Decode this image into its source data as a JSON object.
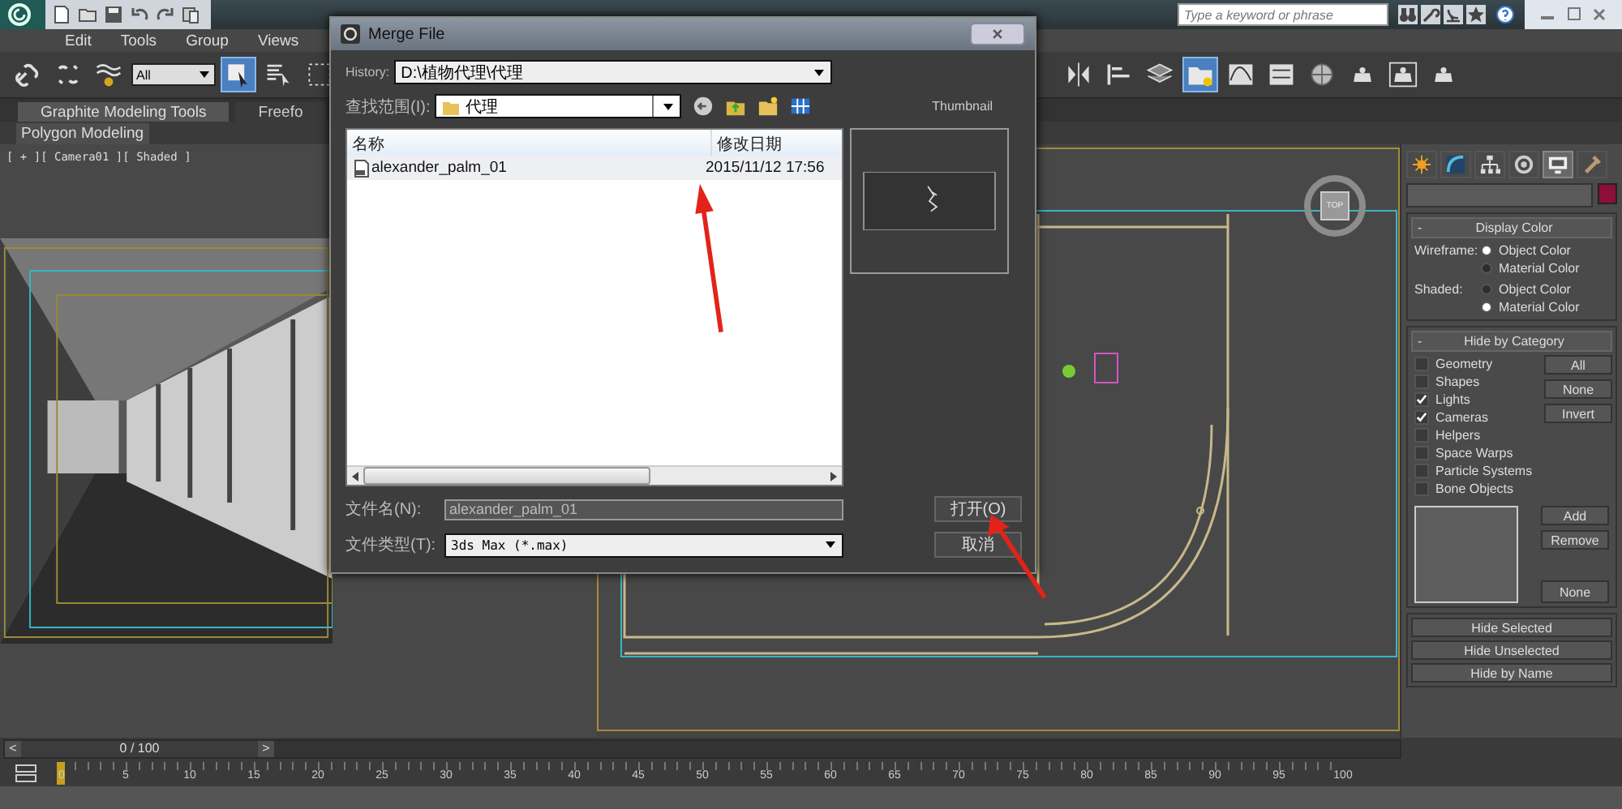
{
  "title_bar": {
    "search": {
      "placeholder": "Type a keyword or phrase"
    }
  },
  "menu": [
    {
      "label": "Edit"
    },
    {
      "label": "Tools"
    },
    {
      "label": "Group"
    },
    {
      "label": "Views"
    }
  ],
  "main_toolbar": {
    "selection_filter": "All",
    "left_tools": [
      {
        "kind": "link",
        "selected": false
      },
      {
        "kind": "unlink",
        "selected": false
      },
      {
        "kind": "bind",
        "selected": false
      }
    ],
    "select_tools": [
      {
        "kind": "select",
        "selected": true
      },
      {
        "kind": "select-name",
        "selected": false
      },
      {
        "kind": "region",
        "selected": false
      }
    ],
    "right_tools": [
      {
        "kind": "mirror",
        "selected": false
      },
      {
        "kind": "align",
        "selected": false
      },
      {
        "kind": "layers",
        "selected": false
      },
      {
        "kind": "explorer",
        "selected": true
      },
      {
        "kind": "curve",
        "selected": false
      },
      {
        "kind": "schematic",
        "selected": false
      },
      {
        "kind": "material",
        "selected": false
      },
      {
        "kind": "render-setup",
        "selected": false
      },
      {
        "kind": "frame",
        "selected": false
      },
      {
        "kind": "render",
        "selected": false
      }
    ]
  },
  "ribbon": {
    "tabs": [
      {
        "label": "Graphite Modeling Tools",
        "selected": true
      },
      {
        "label": "Freefo",
        "selected": false
      }
    ],
    "panel": "Polygon Modeling"
  },
  "viewports": [
    {
      "kind": "camera",
      "label": "[ + ][ Camera01 ][ Shaded ]"
    },
    {
      "kind": "top",
      "view_cube": "TOP"
    }
  ],
  "command_panel": {
    "tabs": [
      {
        "kind": "create",
        "selected": false
      },
      {
        "kind": "modify",
        "selected": false
      },
      {
        "kind": "hierarchy",
        "selected": false
      },
      {
        "kind": "motion",
        "selected": false
      },
      {
        "kind": "display",
        "selected": true
      },
      {
        "kind": "utilities",
        "selected": false
      }
    ],
    "display_color": {
      "toggle": "-",
      "title": "Display Color",
      "groups": [
        {
          "label": "Wireframe:",
          "options": [
            {
              "label": "Object Color",
              "selected": true
            },
            {
              "label": "Material Color",
              "selected": false
            }
          ]
        },
        {
          "label": "Shaded:",
          "options": [
            {
              "label": "Object Color",
              "selected": false
            },
            {
              "label": "Material Color",
              "selected": true
            }
          ]
        }
      ]
    },
    "hide_by_category": {
      "toggle": "-",
      "title": "Hide by Category",
      "items": [
        {
          "label": "Geometry",
          "checked": false
        },
        {
          "label": "Shapes",
          "checked": false
        },
        {
          "label": "Lights",
          "checked": true
        },
        {
          "label": "Cameras",
          "checked": true
        },
        {
          "label": "Helpers",
          "checked": false
        },
        {
          "label": "Space Warps",
          "checked": false
        },
        {
          "label": "Particle Systems",
          "checked": false
        },
        {
          "label": "Bone Objects",
          "checked": false
        }
      ],
      "buttons": [
        "All",
        "None",
        "Invert"
      ],
      "list_buttons": [
        "Add",
        "Remove",
        "None"
      ]
    },
    "hide_buttons": [
      "Hide Selected",
      "Hide Unselected",
      "Hide by Name"
    ]
  },
  "time_slider": {
    "prev": "<",
    "position": "0 / 100",
    "next": ">",
    "level": 0
  },
  "timeline": {
    "labels": [
      "0",
      "5",
      "10",
      "15",
      "20",
      "25",
      "30",
      "35",
      "40",
      "45",
      "50",
      "55",
      "60",
      "65",
      "70",
      "75",
      "80",
      "85",
      "90",
      "95",
      "100"
    ]
  },
  "dialog": {
    "title": "Merge File",
    "history": {
      "label": "History:",
      "value": "D:\\植物代理\\代理"
    },
    "look_in": {
      "label": "查找范围(I):",
      "value": "代理"
    },
    "thumbnail_label": "Thumbnail",
    "columns": [
      "名称",
      "修改日期"
    ],
    "files": [
      {
        "name": "alexander_palm_01",
        "modified": "2015/11/12 17:56",
        "selected": true
      }
    ],
    "file_name": {
      "label": "文件名(N):",
      "value": "alexander_palm_01"
    },
    "file_type": {
      "label": "文件类型(T):",
      "value": "3ds Max (*.max)"
    },
    "buttons": [
      "打开(O)",
      "取消"
    ]
  }
}
